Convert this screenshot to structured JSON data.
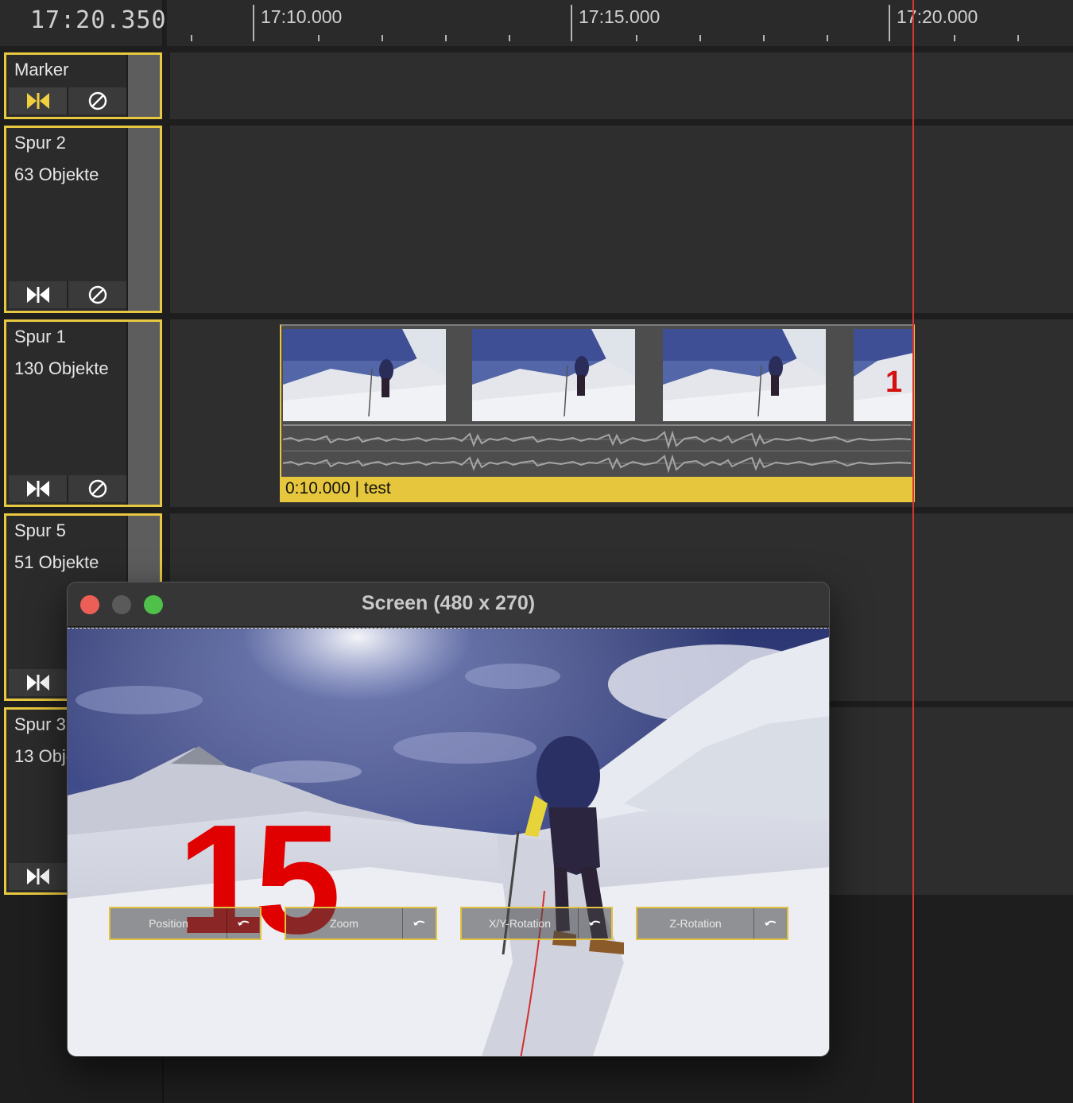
{
  "timecode": "17:20.350",
  "ruler": {
    "labels": [
      "17:10.000",
      "17:15.000",
      "17:20.000"
    ]
  },
  "tracks": [
    {
      "name": "Marker",
      "count": ""
    },
    {
      "name": "Spur 2",
      "count": "63 Objekte"
    },
    {
      "name": "Spur 1",
      "count": "130 Objekte"
    },
    {
      "name": "Spur 5",
      "count": "51 Objekte"
    },
    {
      "name": "Spur 3",
      "count": "13 Objekte"
    }
  ],
  "track_buttons": {
    "solo_icon": "bowtie-icon",
    "mute_icon": "disable-icon"
  },
  "clip": {
    "label": "0:10.000 | test",
    "overlay_number": "1"
  },
  "preview": {
    "title": "Screen (480 x 270)",
    "overlay_number": "15",
    "controls": [
      {
        "label": "Position"
      },
      {
        "label": "Zoom"
      },
      {
        "label": "X/Y-Rotation"
      },
      {
        "label": "Z-Rotation"
      }
    ]
  },
  "colors": {
    "accent": "#e8c840",
    "playhead": "#dd3333",
    "close": "#ec5f57",
    "minimize": "#5a5a5a",
    "zoom": "#4fc04a"
  }
}
